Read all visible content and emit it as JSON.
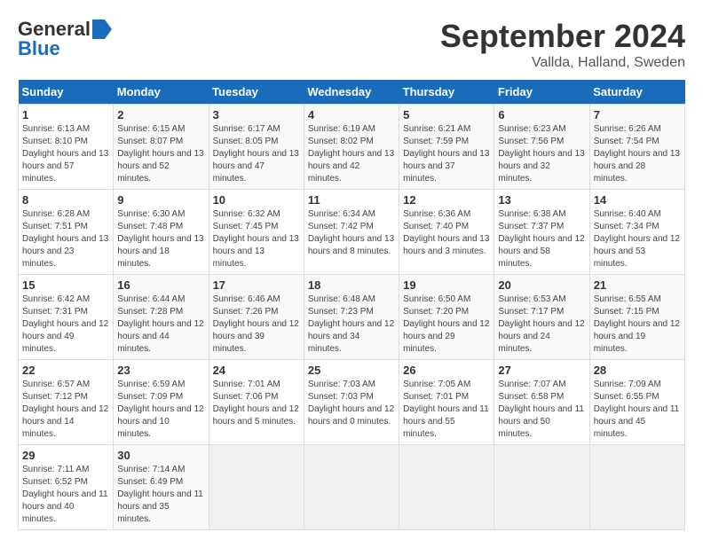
{
  "header": {
    "logo_general": "General",
    "logo_blue": "Blue",
    "month_title": "September 2024",
    "location": "Vallda, Halland, Sweden"
  },
  "weekdays": [
    "Sunday",
    "Monday",
    "Tuesday",
    "Wednesday",
    "Thursday",
    "Friday",
    "Saturday"
  ],
  "weeks": [
    [
      {
        "day": "1",
        "sunrise": "6:13 AM",
        "sunset": "8:10 PM",
        "daylight": "13 hours and 57 minutes."
      },
      {
        "day": "2",
        "sunrise": "6:15 AM",
        "sunset": "8:07 PM",
        "daylight": "13 hours and 52 minutes."
      },
      {
        "day": "3",
        "sunrise": "6:17 AM",
        "sunset": "8:05 PM",
        "daylight": "13 hours and 47 minutes."
      },
      {
        "day": "4",
        "sunrise": "6:19 AM",
        "sunset": "8:02 PM",
        "daylight": "13 hours and 42 minutes."
      },
      {
        "day": "5",
        "sunrise": "6:21 AM",
        "sunset": "7:59 PM",
        "daylight": "13 hours and 37 minutes."
      },
      {
        "day": "6",
        "sunrise": "6:23 AM",
        "sunset": "7:56 PM",
        "daylight": "13 hours and 32 minutes."
      },
      {
        "day": "7",
        "sunrise": "6:26 AM",
        "sunset": "7:54 PM",
        "daylight": "13 hours and 28 minutes."
      }
    ],
    [
      {
        "day": "8",
        "sunrise": "6:28 AM",
        "sunset": "7:51 PM",
        "daylight": "13 hours and 23 minutes."
      },
      {
        "day": "9",
        "sunrise": "6:30 AM",
        "sunset": "7:48 PM",
        "daylight": "13 hours and 18 minutes."
      },
      {
        "day": "10",
        "sunrise": "6:32 AM",
        "sunset": "7:45 PM",
        "daylight": "13 hours and 13 minutes."
      },
      {
        "day": "11",
        "sunrise": "6:34 AM",
        "sunset": "7:42 PM",
        "daylight": "13 hours and 8 minutes."
      },
      {
        "day": "12",
        "sunrise": "6:36 AM",
        "sunset": "7:40 PM",
        "daylight": "13 hours and 3 minutes."
      },
      {
        "day": "13",
        "sunrise": "6:38 AM",
        "sunset": "7:37 PM",
        "daylight": "12 hours and 58 minutes."
      },
      {
        "day": "14",
        "sunrise": "6:40 AM",
        "sunset": "7:34 PM",
        "daylight": "12 hours and 53 minutes."
      }
    ],
    [
      {
        "day": "15",
        "sunrise": "6:42 AM",
        "sunset": "7:31 PM",
        "daylight": "12 hours and 49 minutes."
      },
      {
        "day": "16",
        "sunrise": "6:44 AM",
        "sunset": "7:28 PM",
        "daylight": "12 hours and 44 minutes."
      },
      {
        "day": "17",
        "sunrise": "6:46 AM",
        "sunset": "7:26 PM",
        "daylight": "12 hours and 39 minutes."
      },
      {
        "day": "18",
        "sunrise": "6:48 AM",
        "sunset": "7:23 PM",
        "daylight": "12 hours and 34 minutes."
      },
      {
        "day": "19",
        "sunrise": "6:50 AM",
        "sunset": "7:20 PM",
        "daylight": "12 hours and 29 minutes."
      },
      {
        "day": "20",
        "sunrise": "6:53 AM",
        "sunset": "7:17 PM",
        "daylight": "12 hours and 24 minutes."
      },
      {
        "day": "21",
        "sunrise": "6:55 AM",
        "sunset": "7:15 PM",
        "daylight": "12 hours and 19 minutes."
      }
    ],
    [
      {
        "day": "22",
        "sunrise": "6:57 AM",
        "sunset": "7:12 PM",
        "daylight": "12 hours and 14 minutes."
      },
      {
        "day": "23",
        "sunrise": "6:59 AM",
        "sunset": "7:09 PM",
        "daylight": "12 hours and 10 minutes."
      },
      {
        "day": "24",
        "sunrise": "7:01 AM",
        "sunset": "7:06 PM",
        "daylight": "12 hours and 5 minutes."
      },
      {
        "day": "25",
        "sunrise": "7:03 AM",
        "sunset": "7:03 PM",
        "daylight": "12 hours and 0 minutes."
      },
      {
        "day": "26",
        "sunrise": "7:05 AM",
        "sunset": "7:01 PM",
        "daylight": "11 hours and 55 minutes."
      },
      {
        "day": "27",
        "sunrise": "7:07 AM",
        "sunset": "6:58 PM",
        "daylight": "11 hours and 50 minutes."
      },
      {
        "day": "28",
        "sunrise": "7:09 AM",
        "sunset": "6:55 PM",
        "daylight": "11 hours and 45 minutes."
      }
    ],
    [
      {
        "day": "29",
        "sunrise": "7:11 AM",
        "sunset": "6:52 PM",
        "daylight": "11 hours and 40 minutes."
      },
      {
        "day": "30",
        "sunrise": "7:14 AM",
        "sunset": "6:49 PM",
        "daylight": "11 hours and 35 minutes."
      },
      null,
      null,
      null,
      null,
      null
    ]
  ]
}
